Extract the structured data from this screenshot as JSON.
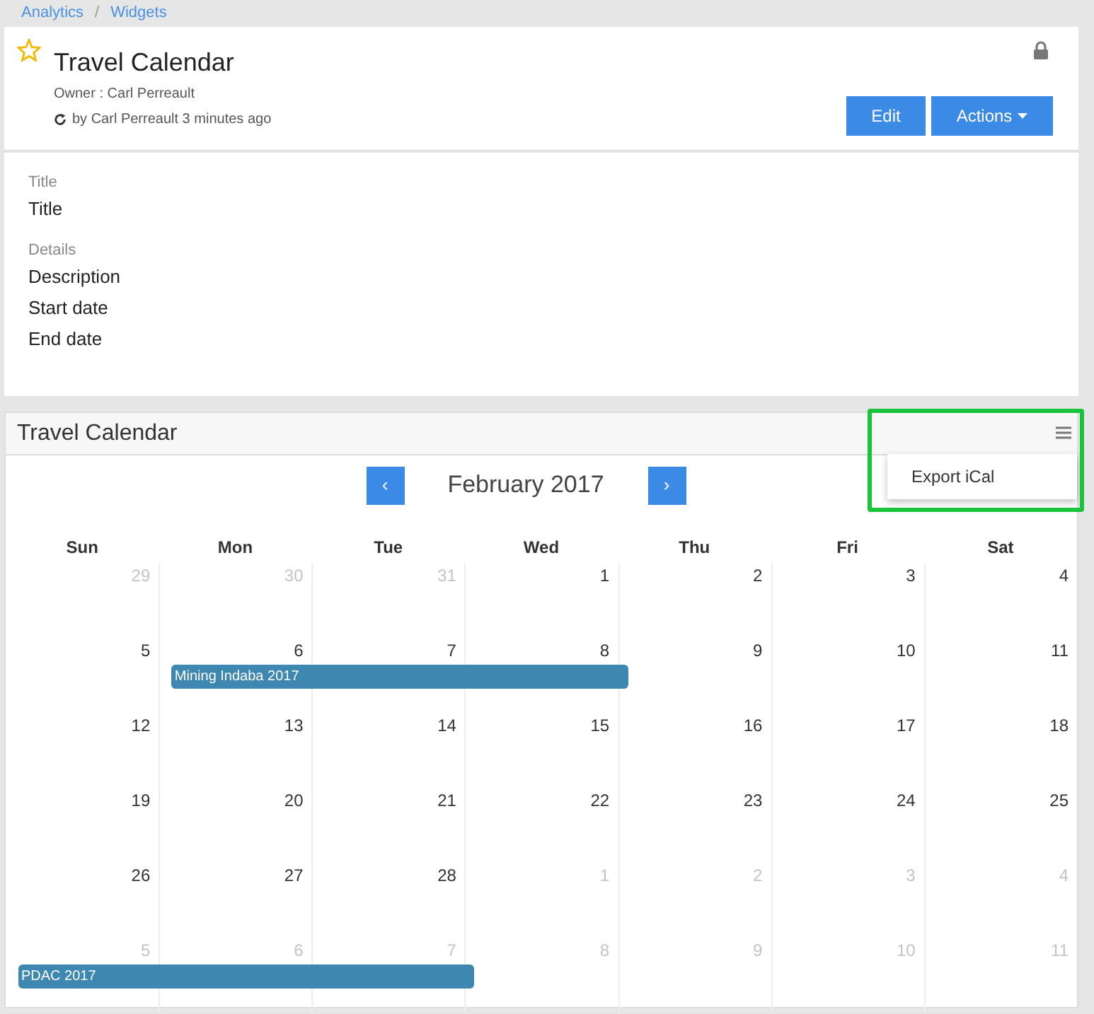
{
  "breadcrumb": {
    "items": [
      "Analytics",
      "Widgets"
    ],
    "separator": "/"
  },
  "header": {
    "title": "Travel Calendar",
    "favorite": false,
    "locked": true,
    "owner": "Owner : Carl Perreault",
    "updated": "by Carl Perreault 3 minutes ago",
    "buttons": [
      {
        "label": "Edit",
        "kind": "plain"
      },
      {
        "label": "Actions",
        "kind": "dropdown"
      }
    ]
  },
  "details": [
    {
      "kind": "label",
      "text": "Title"
    },
    {
      "kind": "value",
      "text": "Title"
    },
    {
      "kind": "label",
      "text": "Details"
    },
    {
      "kind": "value",
      "text": "Description"
    },
    {
      "kind": "value",
      "text": "Start date"
    },
    {
      "kind": "value",
      "text": "End date"
    }
  ],
  "calendar": {
    "title": "Travel Calendar",
    "month": "February 2017",
    "prev": "‹",
    "next": "›",
    "menu": {
      "items": [
        "Export iCal"
      ],
      "highlighted": true
    },
    "weekdays": [
      "Sun",
      "Mon",
      "Tue",
      "Wed",
      "Thu",
      "Fri",
      "Sat"
    ],
    "weeks": [
      [
        {
          "day": "29",
          "outside": true
        },
        {
          "day": "30",
          "outside": true
        },
        {
          "day": "31",
          "outside": true
        },
        {
          "day": "1",
          "outside": false
        },
        {
          "day": "2",
          "outside": false
        },
        {
          "day": "3",
          "outside": false
        },
        {
          "day": "4",
          "outside": false
        }
      ],
      [
        {
          "day": "5",
          "outside": false
        },
        {
          "day": "6",
          "outside": false,
          "event": {
            "title": "Mining Indaba 2017"
          }
        },
        {
          "day": "7",
          "outside": false,
          "event_continues": true
        },
        {
          "day": "8",
          "outside": false,
          "event_continues": true
        },
        {
          "day": "9",
          "outside": false
        },
        {
          "day": "10",
          "outside": false
        },
        {
          "day": "11",
          "outside": false
        }
      ],
      [
        {
          "day": "12",
          "outside": false
        },
        {
          "day": "13",
          "outside": false
        },
        {
          "day": "14",
          "outside": false
        },
        {
          "day": "15",
          "outside": false
        },
        {
          "day": "16",
          "outside": false
        },
        {
          "day": "17",
          "outside": false
        },
        {
          "day": "18",
          "outside": false
        }
      ],
      [
        {
          "day": "19",
          "outside": false
        },
        {
          "day": "20",
          "outside": false
        },
        {
          "day": "21",
          "outside": false
        },
        {
          "day": "22",
          "outside": false
        },
        {
          "day": "23",
          "outside": false
        },
        {
          "day": "24",
          "outside": false
        },
        {
          "day": "25",
          "outside": false
        }
      ],
      [
        {
          "day": "26",
          "outside": false
        },
        {
          "day": "27",
          "outside": false
        },
        {
          "day": "28",
          "outside": false
        },
        {
          "day": "1",
          "outside": true
        },
        {
          "day": "2",
          "outside": true
        },
        {
          "day": "3",
          "outside": true
        },
        {
          "day": "4",
          "outside": true
        }
      ],
      [
        {
          "day": "5",
          "outside": true,
          "event": {
            "title": "PDAC 2017"
          }
        },
        {
          "day": "6",
          "outside": true,
          "event_continues": true
        },
        {
          "day": "7",
          "outside": true,
          "event_continues": true
        },
        {
          "day": "8",
          "outside": true
        },
        {
          "day": "9",
          "outside": true
        },
        {
          "day": "10",
          "outside": true
        },
        {
          "day": "11",
          "outside": true
        }
      ]
    ]
  }
}
